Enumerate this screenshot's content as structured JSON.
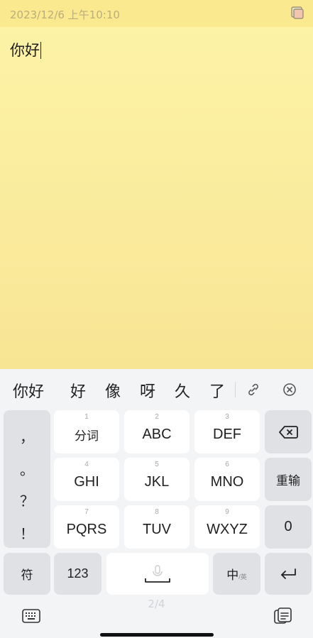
{
  "note": {
    "timestamp": "2023/12/6 上午10:10",
    "text": "你好",
    "header_icon": "note-color-icon"
  },
  "keyboard": {
    "candidates": [
      "你好",
      "好",
      "像",
      "呀",
      "久",
      "了"
    ],
    "actions": [
      "link-icon",
      "close-circle-icon"
    ],
    "symbols": [
      "，",
      "。",
      "？",
      "！"
    ],
    "keys": [
      {
        "num": "1",
        "label": "分词"
      },
      {
        "num": "2",
        "label": "ABC"
      },
      {
        "num": "3",
        "label": "DEF"
      },
      {
        "num": "4",
        "label": "GHI"
      },
      {
        "num": "5",
        "label": "JKL"
      },
      {
        "num": "6",
        "label": "MNO"
      },
      {
        "num": "7",
        "label": "PQRS"
      },
      {
        "num": "8",
        "label": "TUV"
      },
      {
        "num": "9",
        "label": "WXYZ"
      }
    ],
    "right_keys": {
      "backspace_icon": "backspace-icon",
      "reenter": "重输",
      "zero": "0",
      "enter_icon": "enter-icon"
    },
    "bottom_row": {
      "symbols": "符",
      "numbers": "123",
      "space_icon": "microphone-space-icon",
      "lang_main": "中",
      "lang_sub": "/英"
    },
    "page_indicator": "2/4",
    "nav_icons": [
      "keyboard-icon",
      "clipboard-icon"
    ]
  }
}
